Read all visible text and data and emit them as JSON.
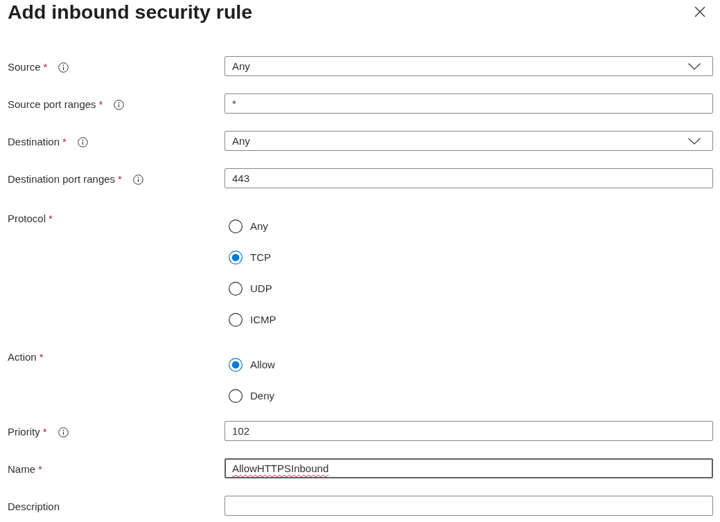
{
  "panel": {
    "title": "Add inbound security rule"
  },
  "fields": [
    {
      "kind": "dropdown",
      "label": "Source",
      "required_mark": "*",
      "info": true,
      "value": "Any"
    },
    {
      "kind": "text",
      "label": "Source port ranges",
      "required_mark": "*",
      "info": true,
      "value": "*"
    },
    {
      "kind": "dropdown",
      "label": "Destination",
      "required_mark": "*",
      "info": true,
      "value": "Any"
    },
    {
      "kind": "text",
      "label": "Destination port ranges",
      "required_mark": "*",
      "info": true,
      "value": "443"
    },
    {
      "kind": "radio",
      "label": "Protocol",
      "required_mark": "*",
      "info": false,
      "options": [
        {
          "label": "Any",
          "selected": false
        },
        {
          "label": "TCP",
          "selected": true
        },
        {
          "label": "UDP",
          "selected": false
        },
        {
          "label": "ICMP",
          "selected": false
        }
      ]
    },
    {
      "kind": "radio",
      "label": "Action",
      "required_mark": "*",
      "info": false,
      "options": [
        {
          "label": "Allow",
          "selected": true
        },
        {
          "label": "Deny",
          "selected": false
        }
      ]
    },
    {
      "kind": "text",
      "label": "Priority",
      "required_mark": "*",
      "info": true,
      "value": "102"
    },
    {
      "kind": "text",
      "label": "Name",
      "required_mark": "*",
      "info": false,
      "value": "AllowHTTPSInbound",
      "focused": true,
      "misspelled": true
    },
    {
      "kind": "text",
      "label": "Description",
      "info": false
    }
  ]
}
